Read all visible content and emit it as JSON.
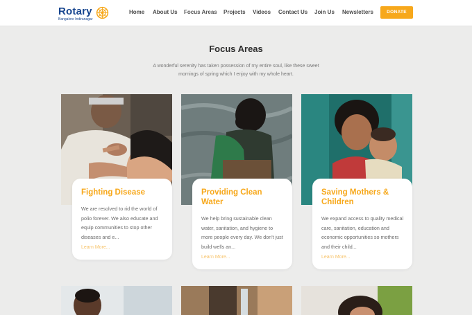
{
  "header": {
    "logo_word": "Rotary",
    "logo_sub": "Bangalore Indiranagar",
    "nav": [
      "Home",
      "About Us",
      "Focus Areas",
      "Projects",
      "Videos",
      "Contact Us",
      "Join Us",
      "Newsletters"
    ],
    "donate_label": "DONATE"
  },
  "focus": {
    "title": "Focus Areas",
    "description": "A wonderful serenity has taken possession of my entire soul, like these sweet mornings of spring which I enjoy with my whole heart."
  },
  "cards": [
    {
      "title": "Fighting Disease",
      "text": "We are resolved to rid the world of polio forever. We also educate and equip communities to stop other diseases and e...",
      "link": "Learn More..."
    },
    {
      "title": "Providing Clean Water",
      "text": "We help bring sustainable clean water, sanitation, and hygiene to more people every day. We don't just build wells an...",
      "link": "Learn More..."
    },
    {
      "title": "Saving Mothers & Children",
      "text": "We expand access to quality medical care, sanitation, education and economic opportunities so mothers and their child...",
      "link": "Learn More..."
    }
  ],
  "colors": {
    "brand_blue": "#17458f",
    "accent_gold": "#f7a81b",
    "page_bg": "#ececeb"
  }
}
